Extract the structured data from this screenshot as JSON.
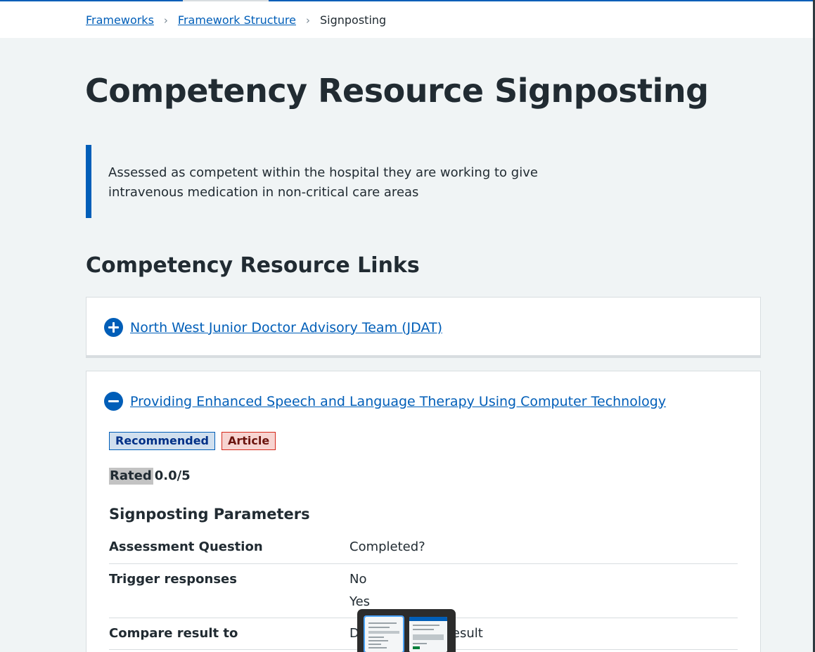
{
  "breadcrumb": {
    "items": [
      {
        "label": "Frameworks",
        "link": true
      },
      {
        "label": "Framework Structure",
        "link": true
      },
      {
        "label": "Signposting",
        "link": false
      }
    ],
    "separator": "›"
  },
  "page": {
    "title": "Competency Resource Signposting",
    "description": "Assessed as competent within the hospital they are working to give intravenous medication in non-critical care areas",
    "description_lines": [
      "Assessed as competent within the hospital they are working to give",
      "intravenous medication in non-critical care areas"
    ]
  },
  "resources": {
    "heading": "Competency Resource Links",
    "items": [
      {
        "title": "North West Junior Doctor Advisory Team (JDAT)",
        "expanded": false,
        "icon": "plus-circle-icon"
      },
      {
        "title": "Providing Enhanced Speech and Language Therapy Using Computer Technology",
        "expanded": true,
        "icon": "minus-circle-icon",
        "tags": [
          "Recommended",
          "Article"
        ],
        "rating_label": "Rated",
        "rating_value": "0.0/5",
        "params_heading": "Signposting Parameters",
        "params": [
          {
            "key": "Assessment Question",
            "values": [
              "Completed?"
            ]
          },
          {
            "key": "Trigger responses",
            "values": [
              "No",
              "Yes"
            ]
          },
          {
            "key": "Compare result to",
            "values": [
              "D",
              "esult"
            ]
          }
        ]
      }
    ]
  },
  "colors": {
    "link": "#005eb8",
    "background": "#f0f4f5",
    "text": "#212b32",
    "tag_blue_bg": "#d0dfee",
    "tag_red_bg": "#f7d4d1"
  }
}
